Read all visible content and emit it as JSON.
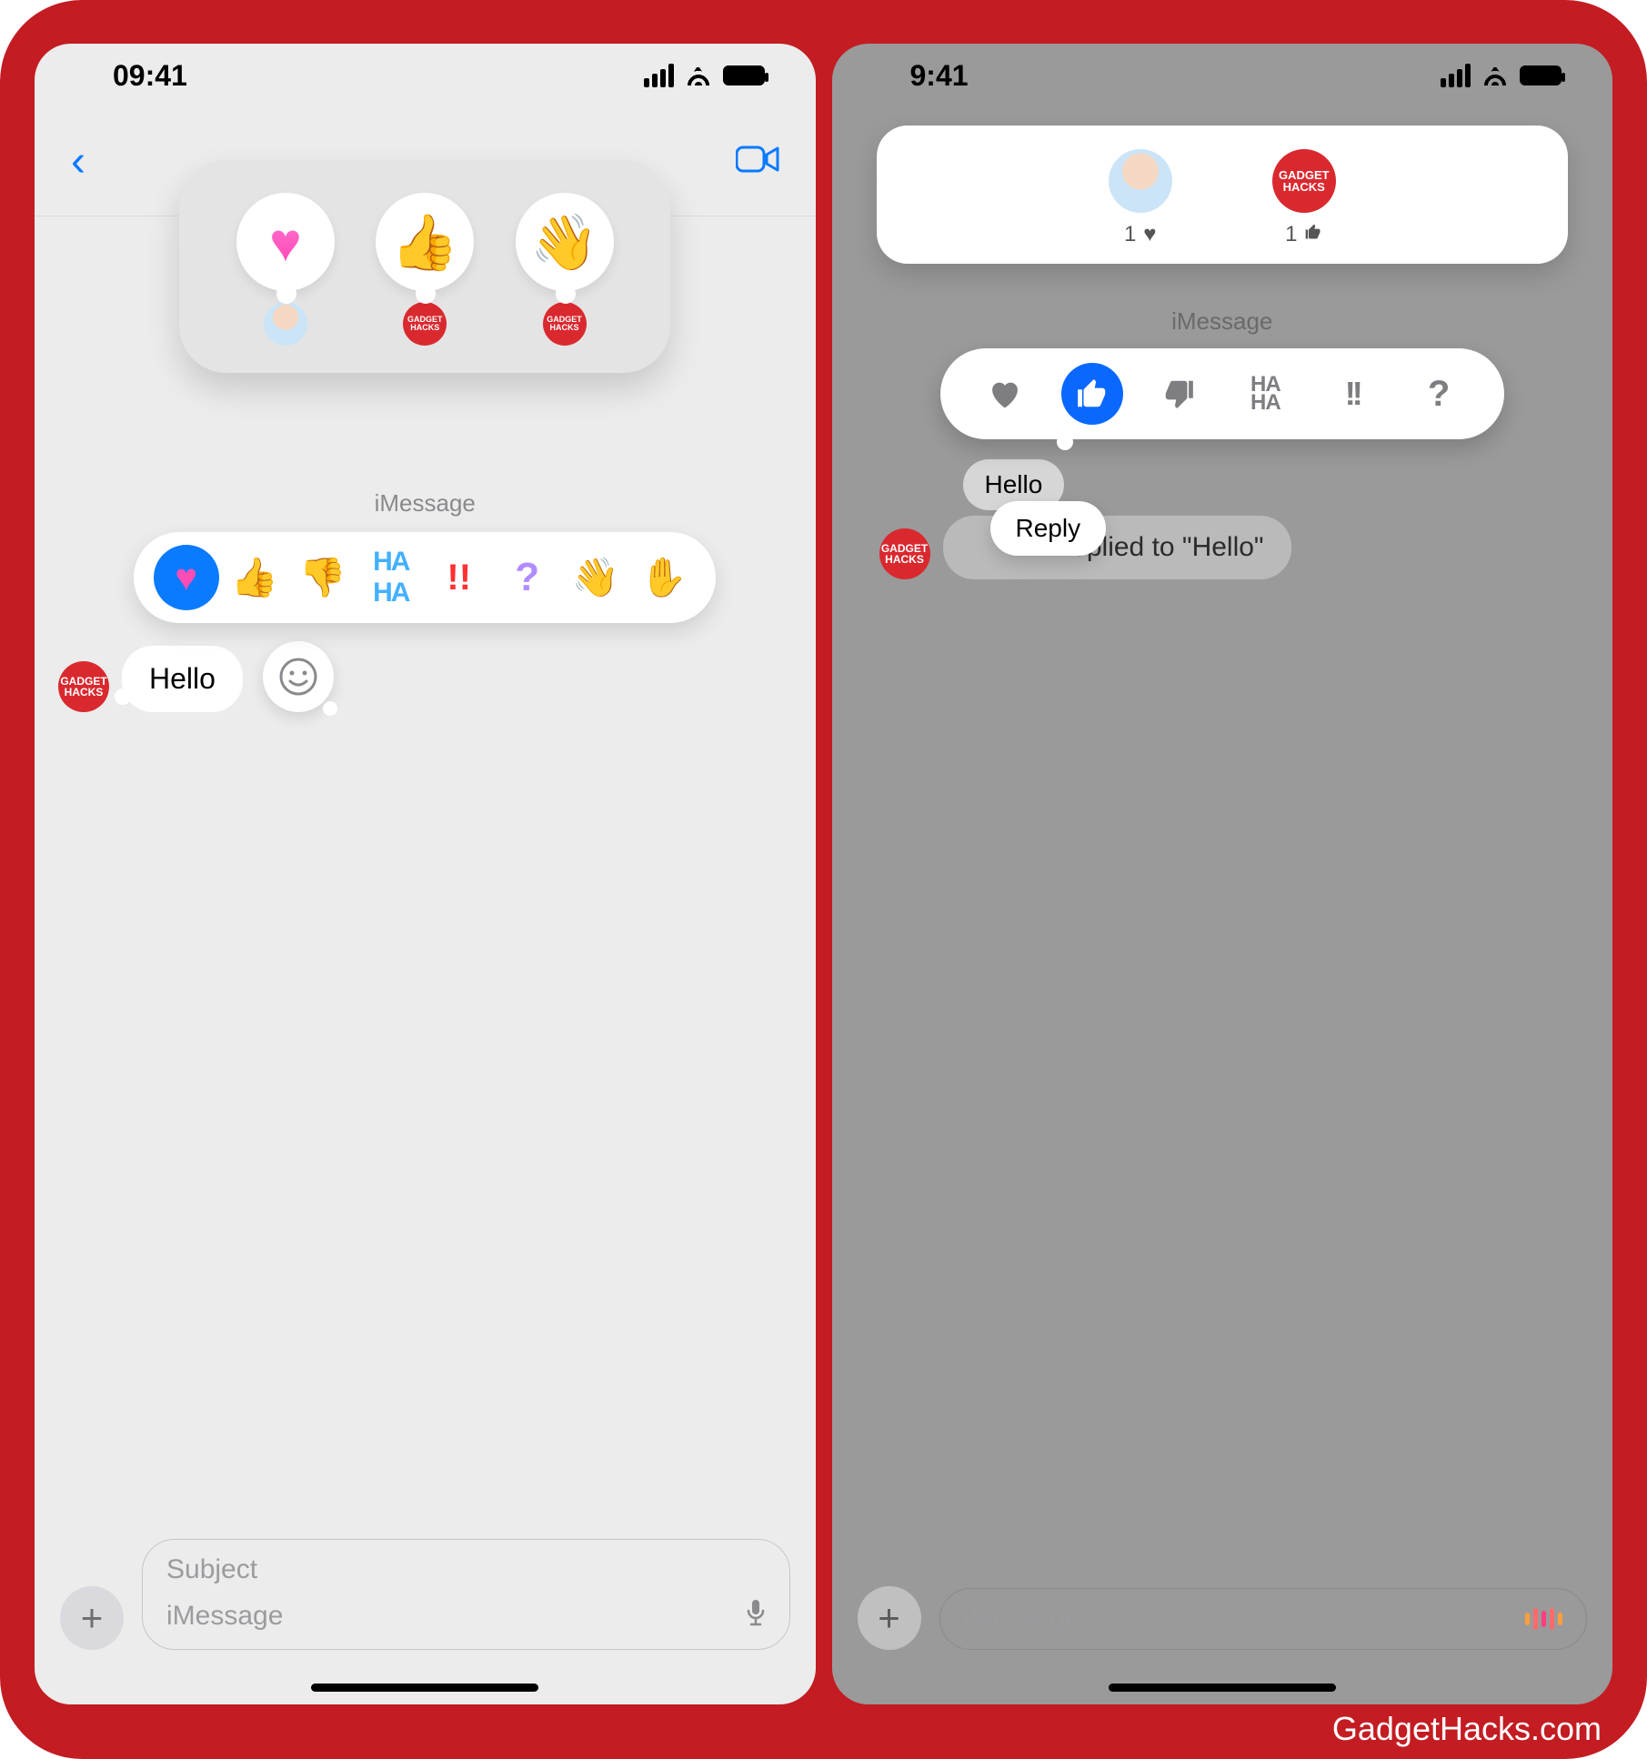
{
  "watermark": "GadgetHacks.com",
  "left": {
    "status_time": "09:41",
    "nav": {
      "back": "‹",
      "video": "video"
    },
    "summary": {
      "reactions": [
        {
          "emoji": "❤️",
          "by": "memoji"
        },
        {
          "emoji": "👍",
          "by": "gadgethacks"
        },
        {
          "emoji": "👋",
          "by": "gadgethacks"
        }
      ]
    },
    "thread_label": "iMessage",
    "tapback_picker": [
      {
        "emoji": "❤️",
        "name": "heart",
        "selected": true
      },
      {
        "emoji": "👍",
        "name": "thumbs-up"
      },
      {
        "emoji": "👎",
        "name": "thumbs-down"
      },
      {
        "emoji": "HAHA",
        "name": "haha"
      },
      {
        "emoji": "‼️",
        "name": "exclaim"
      },
      {
        "emoji": "?",
        "name": "question"
      },
      {
        "emoji": "👋",
        "name": "wave"
      },
      {
        "emoji": "✋",
        "name": "hand"
      }
    ],
    "message": {
      "sender": "GADGET HACKS",
      "text": "Hello"
    },
    "emoji_button": "☺",
    "composer": {
      "subject_ph": "Subject",
      "message_ph": "iMessage",
      "mic": "􀊱"
    }
  },
  "right": {
    "status_time": "9:41",
    "reactors": [
      {
        "avatar": "memoji",
        "count": "1",
        "icon": "heart"
      },
      {
        "avatar": "gadgethacks",
        "count": "1",
        "icon": "thumbs-up"
      }
    ],
    "thread_label": "iMessage",
    "mono_picker": [
      {
        "name": "heart"
      },
      {
        "name": "thumbs-up",
        "selected": true
      },
      {
        "name": "thumbs-down"
      },
      {
        "name": "haha",
        "text": "HA HA"
      },
      {
        "name": "exclaim",
        "text": "!!"
      },
      {
        "name": "question",
        "text": "?"
      }
    ],
    "hello_mini": "Hello",
    "reply_pill": "Reply",
    "quoted": "Replied to \"Hello\"",
    "sender": "GADGET HACKS",
    "composer": {
      "message_ph": "iMessage"
    }
  },
  "gh_label": "GADGET\nHACKS"
}
